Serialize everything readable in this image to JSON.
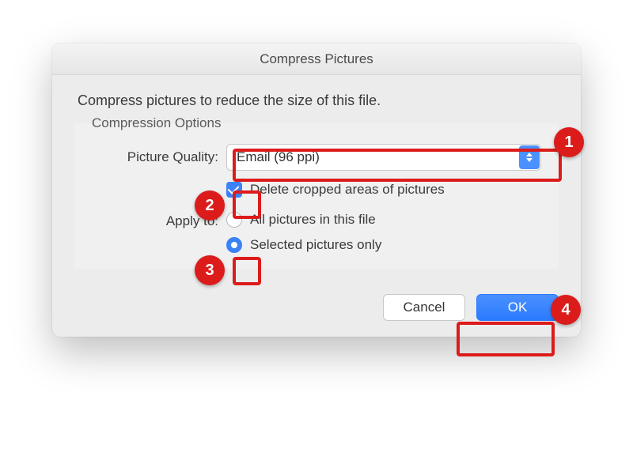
{
  "dialog": {
    "title": "Compress Pictures",
    "lead": "Compress pictures to reduce the size of this file.",
    "group_legend": "Compression Options",
    "quality_label": "Picture Quality:",
    "quality_value": "Email (96 ppi)",
    "delete_cropped_label": "Delete cropped areas of pictures",
    "delete_cropped_checked": true,
    "apply_to_label": "Apply to:",
    "radio_all": "All pictures in this file",
    "radio_selected": "Selected pictures only",
    "radio_choice": "selected",
    "cancel_label": "Cancel",
    "ok_label": "OK"
  },
  "annotations": {
    "n1": "1",
    "n2": "2",
    "n3": "3",
    "n4": "4"
  }
}
